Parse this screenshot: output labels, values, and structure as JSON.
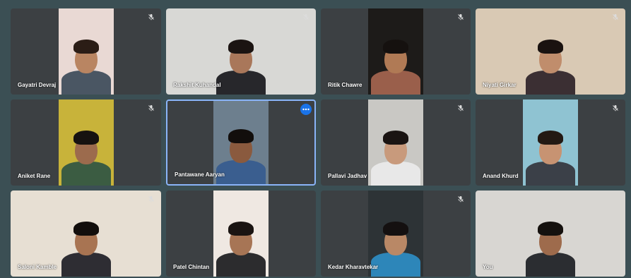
{
  "participants": [
    {
      "name": "Gayatri Devraj",
      "bg": "#e9d9d4",
      "skin": "#b98562",
      "hair": "#2b1d16",
      "shirt": "#4a5663",
      "video": "narrow",
      "muted": true
    },
    {
      "name": "Rakshit Kuhandal",
      "bg": "#d8d8d5",
      "skin": "#a9775a",
      "hair": "#1b1412",
      "shirt": "#27272b",
      "video": "full",
      "muted": true
    },
    {
      "name": "Ritik Chawre",
      "bg": "#1d1b19",
      "skin": "#b07a55",
      "hair": "#15110f",
      "shirt": "#9a5f4b",
      "video": "narrow",
      "muted": true
    },
    {
      "name": "Niyati Girkar",
      "bg": "#d9c9b4",
      "skin": "#c08d6c",
      "hair": "#1a1210",
      "shirt": "#3b2f33",
      "video": "full",
      "muted": true
    },
    {
      "name": "Aniket Rane",
      "bg": "#c8b33a",
      "skin": "#9c6b4d",
      "hair": "#161210",
      "shirt": "#3b5c42",
      "video": "narrow",
      "muted": true
    },
    {
      "name": "Pantawane Aaryan",
      "bg": "#6d7f8e",
      "skin": "#8a5a3e",
      "hair": "#120e0c",
      "shirt": "#3a5e8f",
      "video": "narrow",
      "muted": false,
      "active": true
    },
    {
      "name": "Pallavi Jadhav",
      "bg": "#c9c8c4",
      "skin": "#c89a7c",
      "hair": "#1a1412",
      "shirt": "#e8e8e8",
      "video": "narrow",
      "muted": true
    },
    {
      "name": "Anand Khurd",
      "bg": "#8fc3d2",
      "skin": "#c79372",
      "hair": "#231913",
      "shirt": "#3b4048",
      "video": "narrow",
      "muted": true
    },
    {
      "name": "Saloni Kamble",
      "bg": "#e7dfd3",
      "skin": "#a87452",
      "hair": "#120e0c",
      "shirt": "#2e2d33",
      "video": "full",
      "muted": true
    },
    {
      "name": "Patel Chintan",
      "bg": "#efe8e2",
      "skin": "#a77555",
      "hair": "#1a1412",
      "shirt": "#2c2c2e",
      "video": "narrow",
      "muted": false
    },
    {
      "name": "Kedar Kharavtekar",
      "bg": "#2d3336",
      "skin": "#b98866",
      "hair": "#141010",
      "shirt": "#2d86b9",
      "video": "narrow",
      "muted": true
    },
    {
      "name": "You",
      "bg": "#d8d6d2",
      "skin": "#9e6b4c",
      "hair": "#15110e",
      "shirt": "#2b2d31",
      "video": "full",
      "muted": false
    }
  ],
  "icons": {
    "mic_off": "mic-off-icon",
    "more": "more-options-icon"
  },
  "colors": {
    "tile": "#3c4043",
    "page": "#3b4f54",
    "active_border": "#8ab4f8",
    "accent": "#1a73e8"
  }
}
